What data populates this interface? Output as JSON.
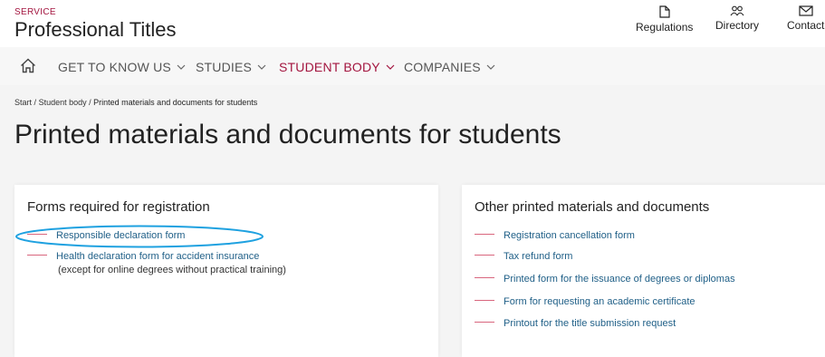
{
  "header": {
    "service": "SERVICE",
    "title": "Professional Titles",
    "actions": [
      {
        "label": "Regulations",
        "icon": "document-icon"
      },
      {
        "label": "Directory",
        "icon": "people-icon"
      },
      {
        "label": "Contact",
        "icon": "mail-icon"
      }
    ]
  },
  "nav": {
    "home_icon": "home-icon",
    "items": [
      {
        "label": "GET TO KNOW US",
        "active": false
      },
      {
        "label": "STUDIES",
        "active": false
      },
      {
        "label": "STUDENT BODY",
        "active": true
      },
      {
        "label": "COMPANIES",
        "active": false
      }
    ]
  },
  "breadcrumb": {
    "items": [
      "Start",
      "Student body"
    ],
    "separator": "/",
    "current": "Printed materials and documents for students"
  },
  "page_title": "Printed materials and documents for students",
  "cards": [
    {
      "title": "Forms required for registration",
      "links": [
        {
          "label": "Responsible declaration form"
        },
        {
          "label": "Health declaration form for accident insurance",
          "note": "(except for online degrees without practical training)"
        }
      ]
    },
    {
      "title": "Other printed materials and documents",
      "links": [
        {
          "label": "Registration cancellation form"
        },
        {
          "label": "Tax refund form"
        },
        {
          "label": "Printed form for the issuance of degrees or diplomas"
        },
        {
          "label": "Form for requesting an academic certificate"
        },
        {
          "label": "Printout for the title submission request"
        }
      ]
    }
  ],
  "colors": {
    "accent": "#a3153f",
    "link": "#1f5f87",
    "dash": "#d9667e",
    "highlight": "#1ea1e0"
  }
}
